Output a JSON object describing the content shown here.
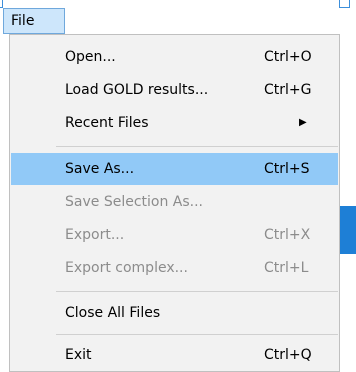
{
  "menu_bar": {
    "file_label": "File"
  },
  "menu": {
    "items": [
      {
        "label": "Open...",
        "shortcut": "Ctrl+O"
      },
      {
        "label": "Load GOLD results...",
        "shortcut": "Ctrl+G"
      },
      {
        "label": "Recent Files",
        "shortcut": ""
      },
      {
        "label": "Save As...",
        "shortcut": "Ctrl+S"
      },
      {
        "label": "Save Selection As...",
        "shortcut": ""
      },
      {
        "label": "Export...",
        "shortcut": "Ctrl+X"
      },
      {
        "label": "Export complex...",
        "shortcut": "Ctrl+L"
      },
      {
        "label": "Close All Files",
        "shortcut": ""
      },
      {
        "label": "Exit",
        "shortcut": "Ctrl+Q"
      }
    ]
  },
  "icons": {
    "submenu_arrow": "triangle-right-icon"
  },
  "colors": {
    "highlight": "#91c9f7",
    "menu_bg": "#f2f2f2",
    "disabled_text": "#8c8c8c",
    "tab_bg": "#cde6fb"
  }
}
